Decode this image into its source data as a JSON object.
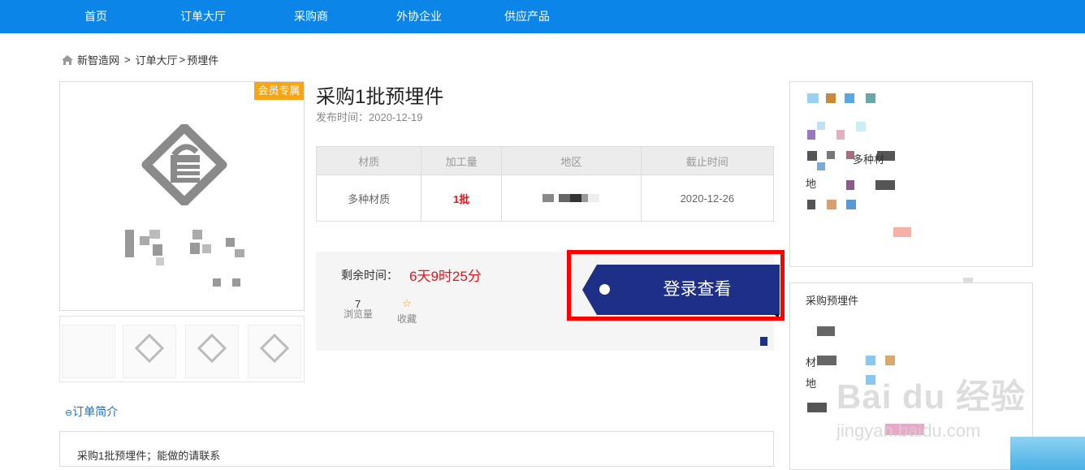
{
  "nav": {
    "items": [
      "首页",
      "订单大厅",
      "采购商",
      "外协企业",
      "供应产品"
    ]
  },
  "breadcrumb": {
    "home": "新智造网",
    "sep1": ">",
    "hall": "订单大厅",
    "sep2": ">",
    "current": "预埋件"
  },
  "product": {
    "badge": "会员专属",
    "title": "采购1批预埋件",
    "publish_label": "发布时间：",
    "publish_date": "2020-12-19"
  },
  "info_table": {
    "headers": [
      "材质",
      "加工量",
      "地区",
      "截止时间"
    ],
    "material": "多种材质",
    "quantity": "1批",
    "deadline": "2020-12-26"
  },
  "status": {
    "remaining_label": "剩余时间：",
    "remaining_value": "6天9时25分",
    "views_count": "7",
    "views_label": "浏览量",
    "favorite_label": "收藏"
  },
  "login_button": "登录查看",
  "intro": {
    "title": "订单简介",
    "text": "采购1批预埋件；能做的请联系"
  },
  "sidebar": {
    "frag_material": "多种材",
    "frag_region": "地",
    "section2_title": "采购预埋件",
    "frag2_material": "材",
    "frag2_region": "地"
  },
  "watermark": {
    "main": "Bai du 经验",
    "sub": "jingyan.baidu.com"
  },
  "colors": {
    "nav": "#0b86e8",
    "badge": "#f6a516",
    "button": "#1d2f87",
    "highlight": "#ff0000",
    "alert": "#e4161c"
  }
}
